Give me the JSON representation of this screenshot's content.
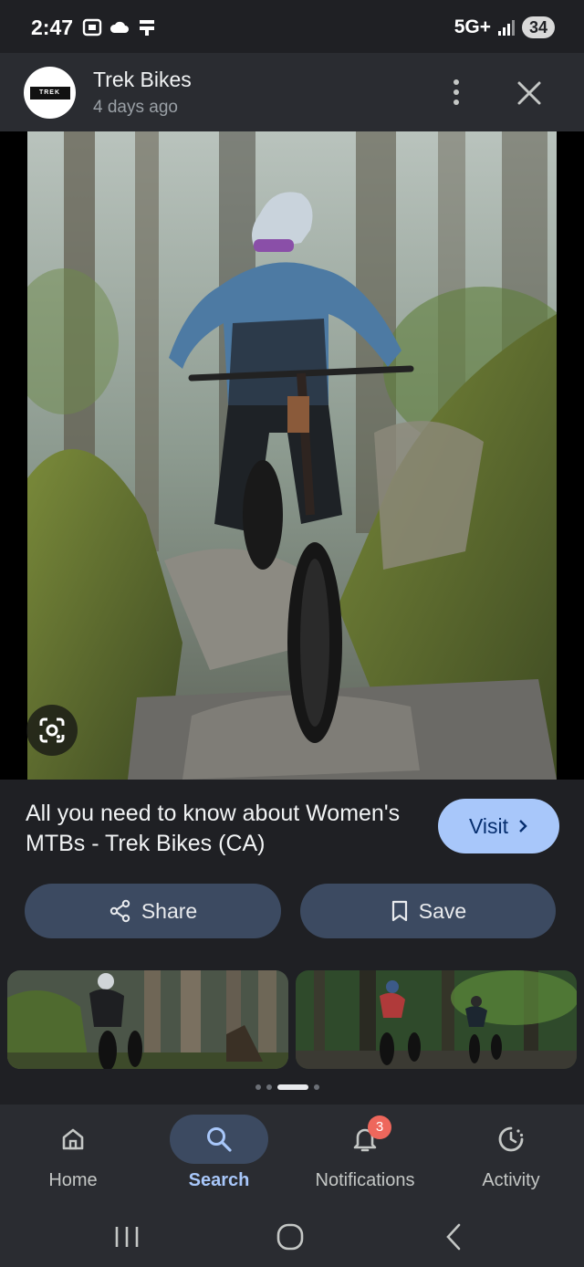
{
  "status_bar": {
    "time": "2:47",
    "network": "5G+",
    "battery": "34",
    "icons": [
      "screenshot-icon",
      "cloud-icon",
      "notification-icon",
      "signal-icon"
    ]
  },
  "header": {
    "source_name": "Trek Bikes",
    "source_age": "4 days ago",
    "avatar_text": "TREK"
  },
  "result": {
    "title": "All you need to know about Women's MTBs - Trek Bikes (CA)",
    "visit_label": "Visit"
  },
  "actions": {
    "share_label": "Share",
    "save_label": "Save"
  },
  "nav": {
    "items": [
      {
        "label": "Home",
        "icon": "home-icon"
      },
      {
        "label": "Search",
        "icon": "search-icon"
      },
      {
        "label": "Notifications",
        "icon": "bell-icon"
      },
      {
        "label": "Activity",
        "icon": "activity-icon"
      }
    ],
    "active": "Search",
    "notification_count": "3"
  },
  "colors": {
    "background": "#1f2024",
    "accent": "#a8c7fa",
    "pill": "#3c4a61",
    "badge": "#ee675c"
  }
}
